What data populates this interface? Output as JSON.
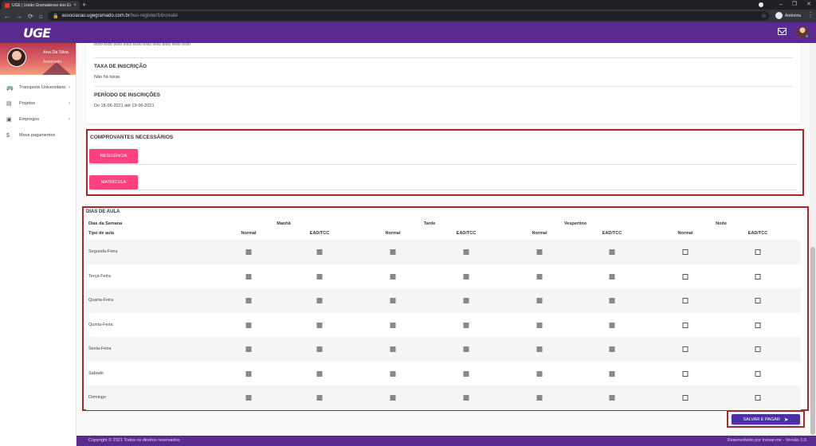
{
  "browser": {
    "tab_title": "UGE | União Gramadense dos Es",
    "tab_close": "×",
    "new_tab": "+",
    "url_host": "associacao.ugegramado.com.br",
    "url_path": "/bus-register/16/create",
    "profile_name": "Andreina",
    "nav_back": "←",
    "nav_forward": "→",
    "nav_reload": "⟳",
    "nav_home": "⌂",
    "star": "☆",
    "menu": "⋮",
    "win_min": "–",
    "win_max": "❐",
    "win_close": "✕"
  },
  "app": {
    "logo": "UGE"
  },
  "sidebar": {
    "user_name": "Ana Da Silva",
    "user_role": "Associado",
    "items": [
      {
        "label": "Transporte Universitário",
        "icon": "bus-icon",
        "glyph": "🚌",
        "chevron": "›"
      },
      {
        "label": "Projetos",
        "icon": "book-icon",
        "glyph": "▤",
        "chevron": "›"
      },
      {
        "label": "Empregos",
        "icon": "id-card-icon",
        "glyph": "▣",
        "chevron": "›"
      },
      {
        "label": "Meus pagamentos",
        "icon": "dollar-icon",
        "glyph": "$",
        "chevron": ""
      }
    ]
  },
  "info": {
    "truncated_text": "texto texto texto texto texto texto texto texto texto texto",
    "fee_heading": "TAXA DE INSCRIÇÃO",
    "fee_value": "Não há taxas",
    "period_heading": "PERÍODO DE INSCRIÇÕES",
    "period_value": "De 18-06-2021 até 19-06-2021"
  },
  "docs": {
    "heading": "COMPROVANTES NECESSÁRIOS",
    "buttons": [
      "RESIDÊNCIA",
      "MATRÍCULA"
    ]
  },
  "schedule": {
    "heading": "DIAS DE AULA",
    "days_label": "Dias da Semana",
    "type_label": "Tipo de aula",
    "periods": [
      "Manhã",
      "Tarde",
      "Vespertino",
      "Noite"
    ],
    "types": [
      "Normal",
      "EAD/TCC"
    ],
    "days": [
      "Segunda-Feira",
      "Terça-Feira",
      "Quarta-Feira",
      "Quinta-Feira",
      "Sexta-Feira",
      "Sabado",
      "Domingo"
    ],
    "disabled_columns": 6
  },
  "actions": {
    "pay_label": "SALVAR E PAGAR",
    "pay_icon": "➤"
  },
  "footer": {
    "left": "Copyright © 2021 Todos os direitos reservados.",
    "right": "Desenvolvido por Inovar.me - Versão 1.0"
  }
}
